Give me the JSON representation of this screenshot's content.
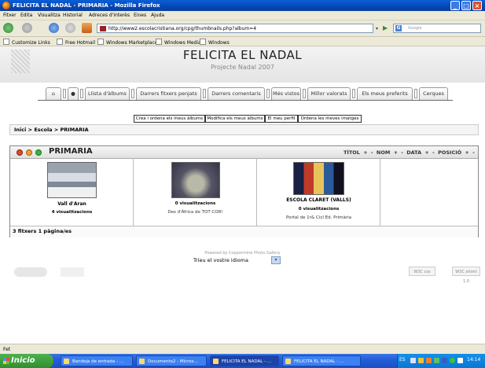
{
  "window": {
    "title": "FELICITA EL NADAL - PRIMARIA - Mozilla Firefox"
  },
  "menubar": [
    "Fitxer",
    "Edita",
    "Visualitza",
    "Historial",
    "Adreces d'interès",
    "Eines",
    "Ajuda"
  ],
  "address": {
    "url": "http://www2.escolacristiana.org/cpg/thumbnails.php?album=4"
  },
  "search": {
    "engine": "G",
    "placeholder": "Google"
  },
  "bookmarks": [
    "Customize Links",
    "Free Hotmail",
    "Windows Marketplace",
    "Windows Media",
    "Windows"
  ],
  "site": {
    "title": "FELICITA EL NADAL",
    "subtitle": "Projecte Nadal 2007"
  },
  "topmenu": [
    "Llista d'àlbums",
    "Darrers fitxers penjats",
    "Darrers comentaris",
    "Més vistos",
    "Millor valorats",
    "Els meus preferits",
    "Cerques"
  ],
  "submenu": [
    "Crea i ordena els meus àlbums",
    "Modifica els meus àlbums",
    "El meu perfil",
    "Ordena les meves imatges"
  ],
  "breadcrumb": {
    "text": "Inici > Escola > PRIMARIA"
  },
  "gallery": {
    "title": "PRIMARIA",
    "sort": "TÍTOL + -   NOM + -   DATA + -   POSICIÓ + -",
    "items": [
      {
        "title": "Vall d'Aran",
        "views": "4 visualitzacions",
        "caption": ""
      },
      {
        "title": "",
        "views": "0 visualitzacions",
        "caption": "Des d'Àfrica de TOT COR!"
      },
      {
        "title": "ESCOLA CLARET (VALLS)",
        "views": "0 visualitzacions",
        "caption": "Portal de 1r& Cicl Ed. Primària"
      }
    ],
    "stats": "3 fitxers 1 pàgina/es"
  },
  "footer": {
    "powered": "Powered by Coppermine Photo Gallery",
    "lang_label": "Trieu el vostre idioma",
    "badges": [
      "W3C css",
      "W3C xhtml 1.0"
    ]
  },
  "statusbar": {
    "text": "Fet"
  },
  "taskbar": {
    "start": "Inicio",
    "tasks": [
      "Bandeja de entrada - ...",
      "Documento2 - Micros...",
      "FELICITA EL NADAL - ...",
      "FELICITA EL NADAL - ..."
    ],
    "tray_lang": "ES",
    "clock": "14:14"
  },
  "colors": {
    "titlebar": "#0646b4",
    "taskbar": "#245edb",
    "start": "#2f8f2f",
    "dot_red": "#e04a2a",
    "dot_orange": "#f0a030",
    "dot_green": "#38b838"
  }
}
